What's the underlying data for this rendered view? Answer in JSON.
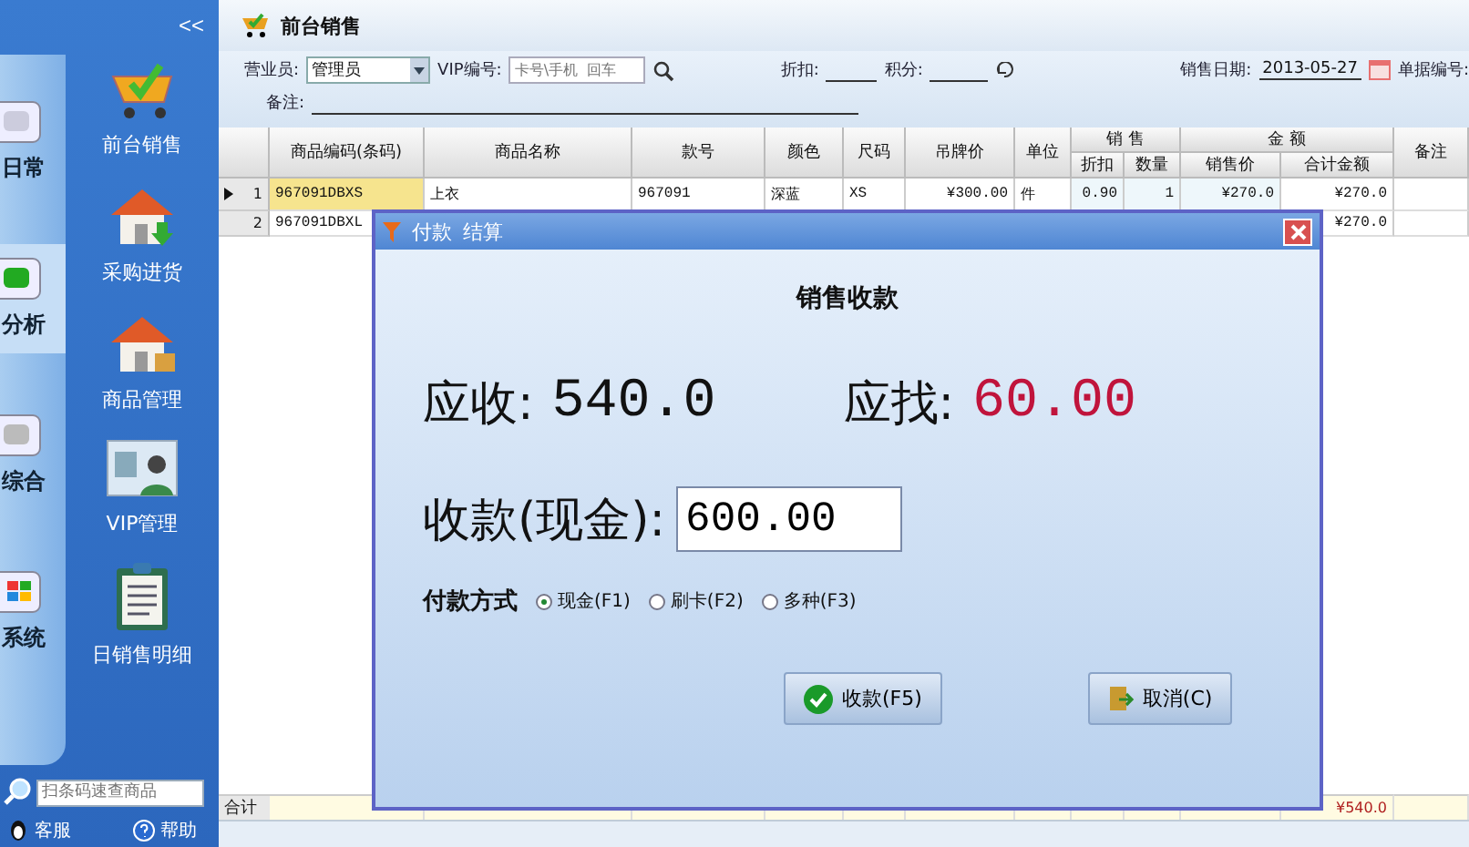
{
  "sidebar": {
    "collapse": "<<",
    "categories": [
      {
        "label": "日常",
        "kind": "daily",
        "selected": false
      },
      {
        "label": "分析",
        "kind": "analysis",
        "selected": true
      },
      {
        "label": "综合",
        "kind": "general",
        "selected": false
      },
      {
        "label": "系统",
        "kind": "system",
        "selected": false
      }
    ],
    "modules": [
      {
        "label": "前台销售",
        "kind": "cart"
      },
      {
        "label": "采购进货",
        "kind": "house-arrow"
      },
      {
        "label": "商品管理",
        "kind": "house-box"
      },
      {
        "label": "VIP管理",
        "kind": "card"
      },
      {
        "label": "日销售明细",
        "kind": "clipboard"
      }
    ],
    "search": {
      "placeholder": "扫条码速查商品"
    },
    "links": [
      {
        "label": "客服",
        "kind": "service"
      },
      {
        "label": "帮助",
        "kind": "help"
      }
    ]
  },
  "main": {
    "title": "前台销售",
    "form": {
      "salesperson_label": "营业员:",
      "salesperson": "管理员",
      "vip_label": "VIP编号:",
      "vip_placeholder": "卡号\\手机  回车",
      "discount_label": "折扣:",
      "points_label": "积分:",
      "date_label": "销售日期:",
      "date": "2013-05-27",
      "order_label": "单据编号:",
      "remark_label": "备注:"
    },
    "table": {
      "columns": [
        {
          "label": "商品编码(条码)"
        },
        {
          "label": "商品名称"
        },
        {
          "label": "款号"
        },
        {
          "label": "颜色"
        },
        {
          "label": "尺码"
        },
        {
          "label": "吊牌价"
        },
        {
          "label": "单位"
        },
        {
          "label": "折扣",
          "group": "销 售"
        },
        {
          "label": "数量",
          "grouped": true
        },
        {
          "label": "销售价",
          "group": "金 额"
        },
        {
          "label": "合计金额",
          "grouped": true
        },
        {
          "label": "备注"
        }
      ],
      "rows": [
        {
          "number": "1",
          "current": true,
          "cells": [
            "967091DBXS",
            "上衣",
            "967091",
            "深蓝",
            "XS",
            "¥300.00",
            "件",
            "0.90",
            "1",
            "¥270.0",
            "¥270.0",
            null
          ]
        },
        {
          "number": "2",
          "current": false,
          "cells": [
            "967091DBXL",
            null,
            null,
            null,
            null,
            null,
            null,
            null,
            null,
            null,
            "¥270.0",
            null
          ]
        }
      ],
      "total_label": "合计",
      "total": "¥540.0"
    }
  },
  "dialog": {
    "title": [
      "付款",
      "结算"
    ],
    "heading": "销售收款",
    "due_label": "应收:",
    "due": "540.0",
    "change_label": "应找:",
    "change": "60.00",
    "received_label": "收款(现金):",
    "received": "600.00",
    "method_label": "付款方式",
    "methods": [
      {
        "label": "现金(F1)",
        "selected": true
      },
      {
        "label": "刷卡(F2)",
        "selected": false
      },
      {
        "label": "多种(F3)",
        "selected": false
      }
    ],
    "buttons": [
      {
        "label": "收款(F5)",
        "kind": "confirm"
      },
      {
        "label": "取消(C)",
        "kind": "cancel"
      }
    ]
  }
}
